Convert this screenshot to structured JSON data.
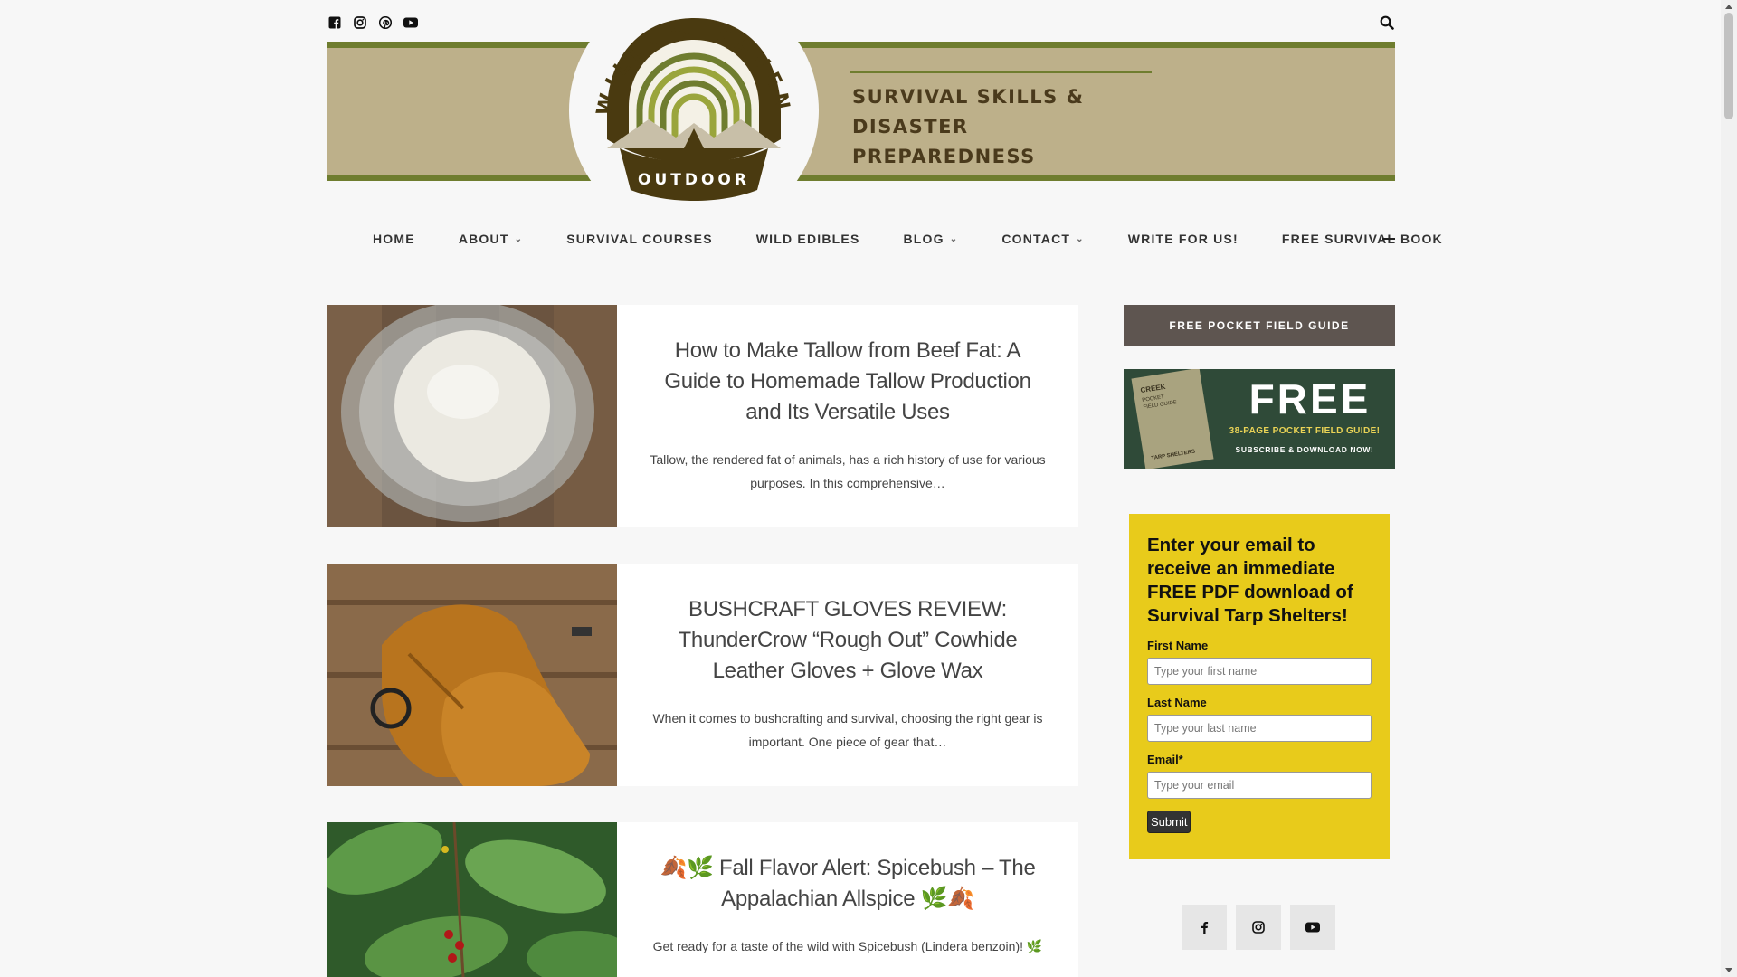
{
  "icons": {
    "facebook": "facebook-icon",
    "instagram": "instagram-icon",
    "pinterest": "pinterest-icon",
    "youtube": "youtube-icon",
    "search": "search-icon"
  },
  "header": {
    "logo_top": "WILLOW HAVEN",
    "logo_bottom": "OUTDOOR",
    "tagline_line1": "SURVIVAL SKILLS &",
    "tagline_line2": "DISASTER PREPAREDNESS"
  },
  "nav": {
    "items": [
      {
        "label": "HOME",
        "dropdown": false
      },
      {
        "label": "ABOUT",
        "dropdown": true
      },
      {
        "label": "SURVIVAL COURSES",
        "dropdown": false
      },
      {
        "label": "WILD EDIBLES",
        "dropdown": false
      },
      {
        "label": "BLOG",
        "dropdown": true
      },
      {
        "label": "CONTACT",
        "dropdown": true
      },
      {
        "label": "WRITE FOR US!",
        "dropdown": false
      },
      {
        "label": "FREE SURVIVAL BOOK",
        "dropdown": false
      }
    ]
  },
  "posts": [
    {
      "title": "How to Make Tallow from Beef Fat: A Guide to Homemade Tallow Production and Its Versatile Uses",
      "excerpt": "Tallow, the rendered fat of animals, has a rich history of use for various purposes. In this comprehensive…"
    },
    {
      "title": "BUSHCRAFT GLOVES REVIEW: ThunderCrow “Rough Out” Cowhide Leather Gloves + Glove Wax",
      "excerpt": "When it comes to bushcrafting and survival, choosing the right gear is important. One piece of gear that…"
    },
    {
      "title": "🍂🌿 Fall Flavor Alert: Spicebush – The Appalachian Allspice 🌿🍂",
      "excerpt": "Get ready for a taste of the wild with Spicebush (Lindera benzoin)! 🌿"
    }
  ],
  "sidebar": {
    "guide_button": "FREE POCKET FIELD GUIDE",
    "ad": {
      "book_brand": "CREEK",
      "book_title": "POCKET FIELD GUIDE",
      "book_sub": "TARP SHELTERS",
      "free": "FREE",
      "line1": "38-PAGE POCKET FIELD GUIDE!",
      "line2": "SUBSCRIBE & DOWNLOAD NOW!"
    },
    "optin": {
      "heading": "Enter your email to receive an immediate FREE PDF download of Survival Tarp Shelters!",
      "first_label": "First Name",
      "first_placeholder": "Type your first name",
      "last_label": "Last Name",
      "last_placeholder": "Type your last name",
      "email_label": "Email*",
      "email_placeholder": "Type your email",
      "submit": "Submit"
    }
  },
  "colors": {
    "banner": "#bdb08a",
    "stripe": "#6f7d2f",
    "logo_brown": "#4a3a10",
    "optin": "#e8cb1b",
    "guide_button": "#5e5550",
    "ad_bg": "#2f4a38"
  }
}
